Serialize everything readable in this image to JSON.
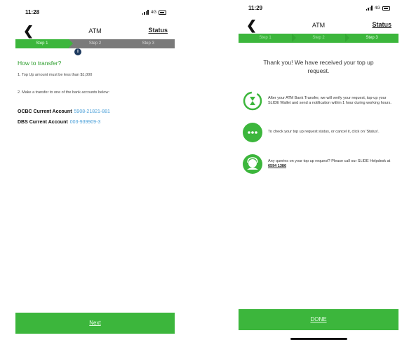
{
  "left": {
    "time": "11:28",
    "network": "4G",
    "back": "❮",
    "title": "ATM",
    "status": "Status",
    "steps": [
      "Step 1",
      "Step 2",
      "Step 3"
    ],
    "info_badge": "i",
    "heading": "How to transfer?",
    "rule1": "1. Top Up amount must be less than $1,000",
    "rule2": "2. Make a transfer to one of the bank accounts below:",
    "accounts": [
      {
        "bank": "OCBC Current Account",
        "number": "5908-21821-881"
      },
      {
        "bank": "DBS Current Account",
        "number": "003-939909-3"
      }
    ],
    "button": "Next"
  },
  "right": {
    "time": "11:29",
    "network": "4G",
    "back": "❮",
    "title": "ATM",
    "status": "Status",
    "steps": [
      "Step 1",
      "Step 2",
      "Step 3"
    ],
    "thanks": "Thank you! We have received your top up request.",
    "items": [
      {
        "icon": "hourglass-icon",
        "text": "After your ATM Bank Transfer, we will verify your request, top-up your SLIDE Wallet and send a notification within 1 hour during working hours."
      },
      {
        "icon": "chat-bubble-icon",
        "text": "To check your top up request status, or cancel it, click on 'Status'."
      },
      {
        "icon": "helpdesk-icon",
        "text_before": "Any queries on your top up request? Please call our SLIDE Helpdesk at",
        "phone": "6594 1386"
      }
    ],
    "button": "DONE"
  },
  "colors": {
    "accent": "#3cb63c",
    "step_bar_gray": "#7a7a7a",
    "link_blue": "#4a9fd8"
  }
}
